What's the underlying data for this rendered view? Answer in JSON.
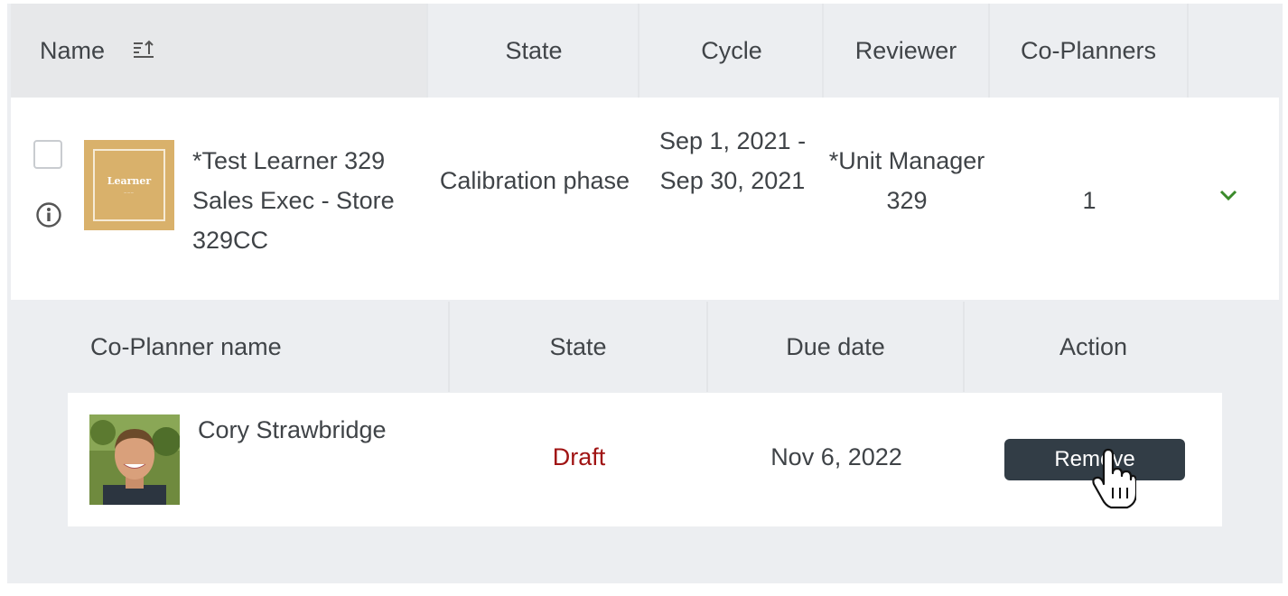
{
  "table": {
    "headers": {
      "name": "Name",
      "state": "State",
      "cycle": "Cycle",
      "reviewer": "Reviewer",
      "co_planners": "Co-Planners"
    },
    "row": {
      "thumbnail_title": "Learner",
      "learner_name": "*Test Learner 329 Sales Exec - Store 329CC",
      "state": "Calibration phase",
      "cycle": "Sep 1, 2021 - Sep 30, 2021",
      "reviewer": "*Unit Manager 329",
      "co_planners_count": "1"
    }
  },
  "co_planner_table": {
    "headers": {
      "name": "Co-Planner name",
      "state": "State",
      "due_date": "Due date",
      "action": "Action"
    },
    "row": {
      "name": "Cory Strawbridge",
      "state": "Draft",
      "due_date": "Nov 6, 2022",
      "action_label": "Remove"
    }
  },
  "colors": {
    "draft_state": "#a01414",
    "remove_button": "#323d46",
    "chevron": "#3a8a2a",
    "thumbnail": "#d9b16b"
  },
  "icons": [
    "sort-ascending-icon",
    "info-icon",
    "chevron-down-icon",
    "hand-pointer-cursor"
  ]
}
